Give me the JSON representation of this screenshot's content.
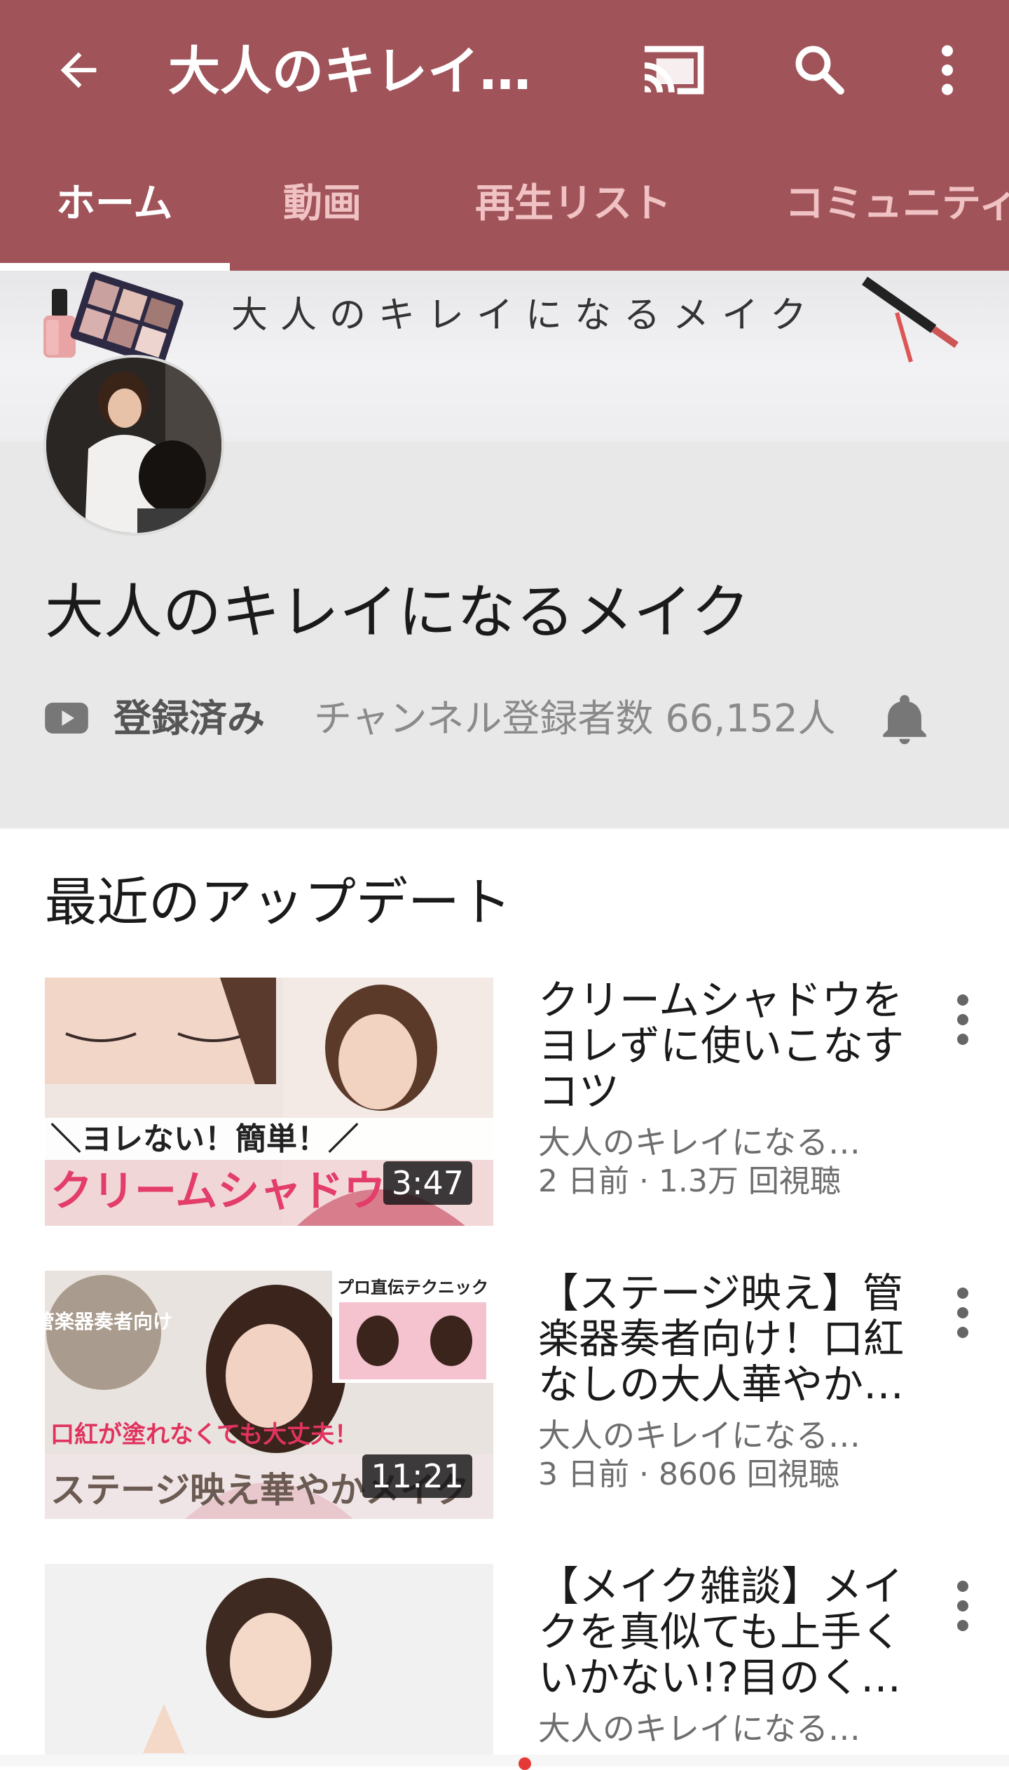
{
  "app_bar": {
    "title": "大人のキレイ…",
    "back_icon": "arrow-left-icon",
    "cast_icon": "cast-icon",
    "search_icon": "search-icon",
    "more_icon": "more-vertical-icon",
    "color": "#a0545a"
  },
  "tabs": [
    {
      "label": "ホーム",
      "active": true
    },
    {
      "label": "動画",
      "active": false
    },
    {
      "label": "再生リスト",
      "active": false
    },
    {
      "label": "コミュニティ",
      "active": false
    }
  ],
  "banner": {
    "text": "大人のキレイになるメイク"
  },
  "channel": {
    "name": "大人のキレイになるメイク",
    "subscribed_label": "登録済み",
    "subscriber_count": "チャンネル登録者数 66,152人"
  },
  "section": {
    "title": "最近のアップデート"
  },
  "videos": [
    {
      "title_lines": [
        "クリームシャドウを",
        "ヨレずに使いこなす",
        "コツ"
      ],
      "channel": "大人のキレイになる…",
      "meta": "2 日前 · 1.3万 回視聴",
      "duration": "3:47",
      "thumb_text_top": "＼ヨレない！簡単！／",
      "thumb_text_bottom": "クリームシャドウ"
    },
    {
      "title_lines": [
        "【ステージ映え】管",
        "楽器奏者向け！口紅",
        "なしの大人華やか…"
      ],
      "channel": "大人のキレイになる…",
      "meta": "3 日前 · 8606 回視聴",
      "duration": "11:21",
      "thumb_badge": "管楽器奏者向け",
      "thumb_tag": "プロ直伝テクニック",
      "thumb_text_mid": "口紅が塗れなくても大丈夫！",
      "thumb_text_bottom": "ステージ映え華やかメイク"
    },
    {
      "title_lines": [
        "【メイク雑談】メイ",
        "クを真似ても上手く",
        "いかない!?目のく…"
      ],
      "channel": "大人のキレイになる…"
    }
  ]
}
